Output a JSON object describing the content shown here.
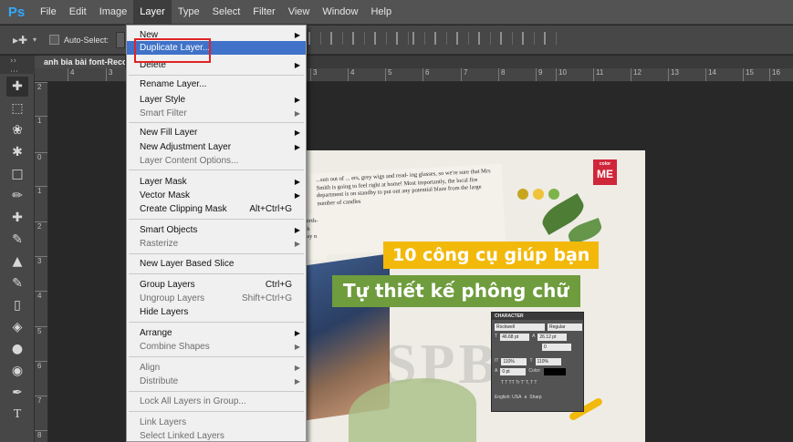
{
  "app": {
    "logo": "Ps"
  },
  "menubar": {
    "items": [
      "File",
      "Edit",
      "Image",
      "Layer",
      "Type",
      "Select",
      "Filter",
      "View",
      "Window",
      "Help"
    ],
    "active": "Layer"
  },
  "options_bar": {
    "auto_select_label": "Auto-Select:"
  },
  "document": {
    "tab_title": "anh bia bài font-Recolor"
  },
  "ruler": {
    "top_ticks": [
      "4",
      "3",
      "3",
      "4",
      "5",
      "6",
      "7",
      "8",
      "9",
      "10",
      "11",
      "12",
      "13",
      "14",
      "15",
      "16"
    ],
    "left_ticks": [
      "2",
      "1",
      "0",
      "1",
      "2",
      "3",
      "4",
      "5",
      "6",
      "7",
      "8"
    ]
  },
  "layer_menu": {
    "items": [
      {
        "label": "New",
        "submenu": true,
        "disabled": false
      },
      {
        "label": "Duplicate Layer...",
        "highlighted": true,
        "disabled": false
      },
      {
        "label": "Delete",
        "submenu": true,
        "disabled": false
      },
      {
        "label": "Rename Layer...",
        "disabled": false
      },
      {
        "label": "Layer Style",
        "submenu": true,
        "disabled": false
      },
      {
        "label": "Smart Filter",
        "submenu": true,
        "disabled": true
      },
      {
        "label": "New Fill Layer",
        "submenu": true,
        "disabled": false
      },
      {
        "label": "New Adjustment Layer",
        "submenu": true,
        "disabled": false
      },
      {
        "label": "Layer Content Options...",
        "disabled": true
      },
      {
        "label": "Layer Mask",
        "submenu": true,
        "disabled": false
      },
      {
        "label": "Vector Mask",
        "submenu": true,
        "disabled": false
      },
      {
        "label": "Create Clipping Mask",
        "shortcut": "Alt+Ctrl+G",
        "disabled": false
      },
      {
        "label": "Smart Objects",
        "submenu": true,
        "disabled": false
      },
      {
        "label": "Rasterize",
        "submenu": true,
        "disabled": true
      },
      {
        "label": "New Layer Based Slice",
        "disabled": false
      },
      {
        "label": "Group Layers",
        "shortcut": "Ctrl+G",
        "disabled": false
      },
      {
        "label": "Ungroup Layers",
        "shortcut": "Shift+Ctrl+G",
        "disabled": true
      },
      {
        "label": "Hide Layers",
        "disabled": false
      },
      {
        "label": "Arrange",
        "submenu": true,
        "disabled": false
      },
      {
        "label": "Combine Shapes",
        "submenu": true,
        "disabled": true
      },
      {
        "label": "Align",
        "submenu": true,
        "disabled": true
      },
      {
        "label": "Distribute",
        "submenu": true,
        "disabled": true
      },
      {
        "label": "Lock All Layers in Group...",
        "disabled": true
      },
      {
        "label": "Link Layers",
        "disabled": true
      },
      {
        "label": "Select Linked Layers",
        "disabled": true
      }
    ]
  },
  "artwork": {
    "logo_small": "color",
    "logo": "ME",
    "headline_1": "10 công cụ giúp bạn",
    "headline_2": "Tự thiết kế phông chữ",
    "paper_text_1": "...sun out of ... ers, grey wigs and read- ing glasses, so we're sure that Mrs Smith is going to feel right at home! Most importantly, the local fire department is on standby to put out any potential blaze from the large number of candles",
    "paper_text_2": "0th birth- Smith irthday n to s",
    "colors": {
      "yellow": "#f2b90b",
      "green": "#6f9c3d",
      "dot1": "#c8a51f",
      "dot2": "#f0c23a",
      "dot3": "#7db34a"
    }
  },
  "character_panel": {
    "title": "CHARACTER",
    "font": "Rockwell",
    "style": "Regular",
    "size": "46.68 pt",
    "leading": "26.12 pt",
    "tracking": "0",
    "vscale": "110%",
    "hscale": "110%",
    "baseline": "0 pt",
    "color_label": "Color:",
    "language": "English: USA",
    "aa_label": "Sharp",
    "aa_prefix": "a",
    "style_buttons": "T T TT Tr T' T, T T"
  }
}
